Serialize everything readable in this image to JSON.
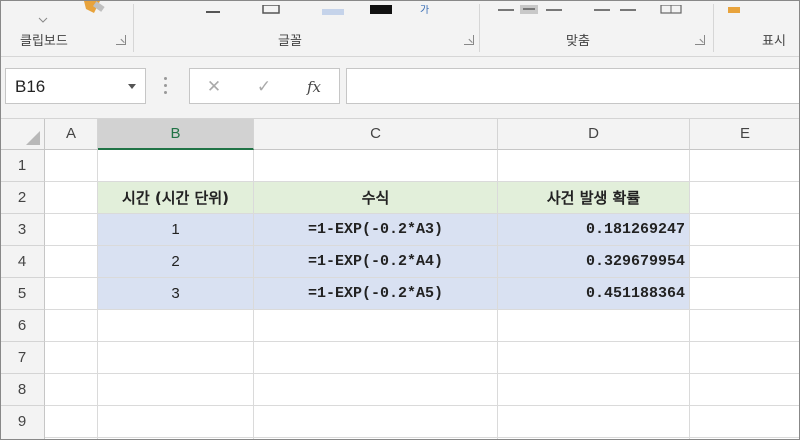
{
  "ribbon": {
    "groups": [
      {
        "label": "클립보드"
      },
      {
        "label": "글꼴"
      },
      {
        "label": "맞춤"
      },
      {
        "label": "표시"
      }
    ]
  },
  "formula_bar": {
    "name_box": "B16",
    "cancel_icon": "✕",
    "enter_icon": "✓",
    "fx_label": "fx",
    "formula": ""
  },
  "sheet": {
    "columns": [
      "A",
      "B",
      "C",
      "D",
      "E"
    ],
    "selected_column": "B",
    "rows": [
      "1",
      "2",
      "3",
      "4",
      "5",
      "6",
      "7",
      "8",
      "9"
    ],
    "headers": {
      "b": "시간 (시간 단위)",
      "c": "수식",
      "d": "사건 발생 확률"
    },
    "data": [
      {
        "b": "1",
        "c": "=1-EXP(-0.2*A3)",
        "d": "0.181269247"
      },
      {
        "b": "2",
        "c": "=1-EXP(-0.2*A4)",
        "d": "0.329679954"
      },
      {
        "b": "3",
        "c": "=1-EXP(-0.2*A5)",
        "d": "0.451188364"
      }
    ],
    "colors": {
      "header_fill": "#e2efda",
      "body_fill": "#d9e1f2",
      "selected_accent": "#217346"
    }
  }
}
